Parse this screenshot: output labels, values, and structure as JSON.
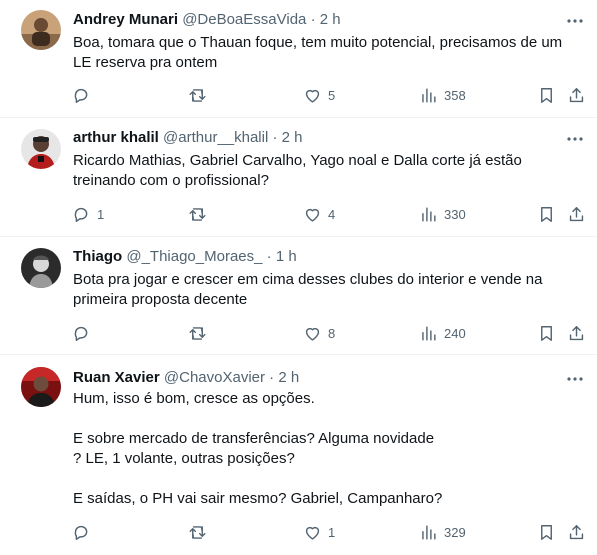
{
  "tweets": [
    {
      "name": "Andrey Munari",
      "handle": "@DeBoaEssaVida",
      "dot": "·",
      "time": "2 h",
      "lines": [
        "Boa, tomara que o Thauan foque, tem muito potencial, precisamos de um",
        "LE reserva pra ontem"
      ],
      "replies": "",
      "retweets": "",
      "likes": "5",
      "views": "358"
    },
    {
      "name": "arthur khalil",
      "handle": "@arthur__khalil",
      "dot": "·",
      "time": "2 h",
      "lines": [
        "Ricardo Mathias, Gabriel Carvalho, Yago noal e Dalla corte já estão",
        "treinando com o profissional?"
      ],
      "replies": "1",
      "retweets": "",
      "likes": "4",
      "views": "330"
    },
    {
      "name": "Thiago",
      "handle": "@_Thiago_Moraes_",
      "dot": "·",
      "time": "1 h",
      "lines": [
        "Bota pra jogar e crescer em cima desses clubes do interior e vende na",
        "primeira proposta decente"
      ],
      "replies": "",
      "retweets": "",
      "likes": "8",
      "views": "240"
    },
    {
      "name": "Ruan Xavier",
      "handle": "@ChavoXavier",
      "dot": "·",
      "time": "2 h",
      "lines": [
        "Hum, isso é bom,  cresce as opções.",
        "",
        "E sobre mercado de transferências? Alguma novidade",
        "? LE, 1 volante, outras posições?",
        "",
        "E saídas, o PH vai sair mesmo? Gabriel, Campanharo?"
      ],
      "replies": "",
      "retweets": "",
      "likes": "1",
      "views": "329"
    }
  ],
  "icons": {
    "more": "more-icon",
    "reply": "reply-icon",
    "retweet": "retweet-icon",
    "like": "like-icon",
    "views": "views-icon",
    "bookmark": "bookmark-icon",
    "share": "share-icon"
  },
  "colors": {
    "text": "#0f1419",
    "secondary": "#536471",
    "divider": "#eff3f4"
  }
}
